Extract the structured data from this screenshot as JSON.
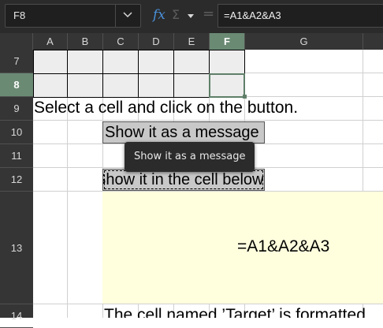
{
  "name_box": {
    "value": "F8"
  },
  "formula_bar": {
    "function_wizard_icon": "fx",
    "sum_icon": "Σ",
    "equals_icon": "=",
    "formula": "=A1&A2&A3"
  },
  "columns": [
    "A",
    "B",
    "C",
    "D",
    "E",
    "F",
    "G"
  ],
  "active_column": "F",
  "rows": [
    "7",
    "8",
    "9",
    "10",
    "11",
    "12",
    "13",
    "14"
  ],
  "active_row": "8",
  "cells": {
    "instruction": "Select a cell and click on the button.",
    "button_message": "Show it as a message",
    "button_cell_below": "Show it in the cell below",
    "target_value": "=A1&A2&A3",
    "note": "The cell named ’Target’ is formatted"
  },
  "tooltip": {
    "text": "Show it as a message"
  },
  "colors": {
    "accent_header": "#6a8a74",
    "target_fill": "#ffffde"
  }
}
